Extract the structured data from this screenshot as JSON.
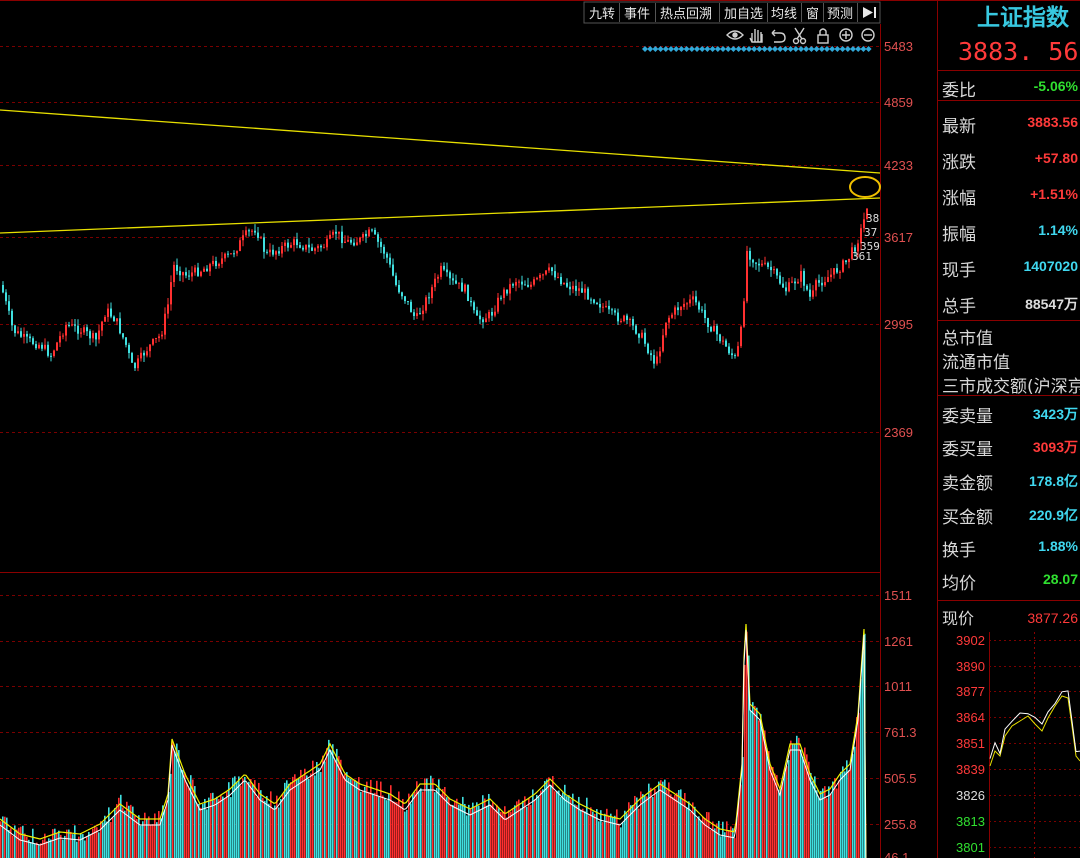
{
  "toolbar": {
    "buttons": [
      "九转",
      "事件",
      "热点回溯",
      "加自选",
      "均线",
      "窗",
      "预测"
    ],
    "nav_arrow": "▶|"
  },
  "icons": [
    "eye-icon",
    "hand-icon",
    "undo-icon",
    "scissors-icon",
    "lock-icon",
    "zoom-in-icon",
    "zoom-out-icon"
  ],
  "colors": {
    "up": "#ff3030",
    "down": "#40e0e0",
    "trendline": "#e8e000",
    "grid": "#7a0000",
    "neutral": "#dcdcdc",
    "cyan_value": "#40d8f0",
    "green_value": "#30e030"
  },
  "price_chart": {
    "y_ticks": [
      "5483",
      "4859",
      "4233",
      "3617",
      "2995",
      "2369"
    ],
    "last_price_labels": [
      "38",
      "37",
      "359",
      "361"
    ]
  },
  "volume_chart": {
    "y_ticks": [
      "1511",
      "1261",
      "1011",
      "761.3",
      "505.5",
      "255.8"
    ],
    "bottom_cut_label": "46.1"
  },
  "quote": {
    "index_name": "上证指数",
    "price": "3883. 56",
    "rows": [
      {
        "label": "委比",
        "value": "-5.06%",
        "color": "green"
      },
      {
        "label": "最新",
        "value": "3883.56",
        "color": "red"
      },
      {
        "label": "涨跌",
        "value": "+57.80",
        "color": "red"
      },
      {
        "label": "涨幅",
        "value": "+1.51%",
        "color": "red"
      },
      {
        "label": "振幅",
        "value": "1.14%",
        "color": "cyan"
      },
      {
        "label": "现手",
        "value": "1407020",
        "color": "cyan"
      },
      {
        "label": "总手",
        "value": "88547万",
        "color": "white"
      }
    ],
    "info_rows": [
      "总市值",
      "流通市值",
      "三市成交额(沪深京)"
    ],
    "rows2": [
      {
        "label": "委卖量",
        "value": "3423万",
        "color": "cyan"
      },
      {
        "label": "委买量",
        "value": "3093万",
        "color": "red"
      },
      {
        "label": "卖金额",
        "value": "178.8亿",
        "color": "cyan"
      },
      {
        "label": "买金额",
        "value": "220.9亿",
        "color": "cyan"
      },
      {
        "label": "换手",
        "value": "1.88%",
        "color": "cyan"
      },
      {
        "label": "均价",
        "value": "28.07",
        "color": "green"
      }
    ]
  },
  "mini_chart": {
    "label": "现价",
    "value": "3877.26",
    "y_ticks": [
      "3902",
      "3890",
      "3877",
      "3864",
      "3851",
      "3839",
      "3826",
      "3813",
      "3801"
    ]
  }
}
